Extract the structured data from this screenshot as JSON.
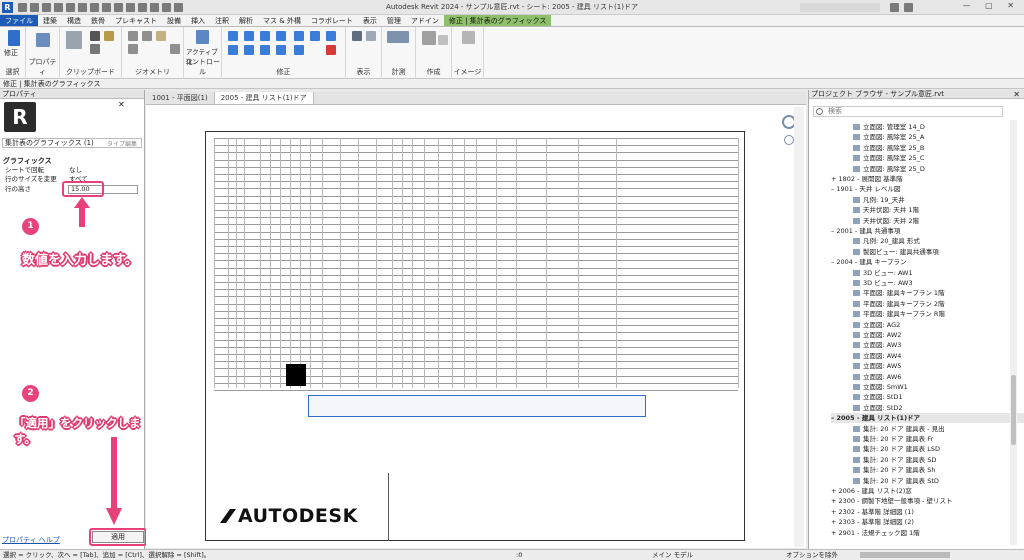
{
  "window": {
    "title": "Autodesk Revit 2024 - サンプル意匠.rvt - シート: 2005 - 建具 リスト(1)ドア",
    "controls": "— ▢ ✕"
  },
  "ribbon_tabs": [
    "ファイル",
    "建築",
    "構造",
    "鉄骨",
    "プレキャスト",
    "設備",
    "挿入",
    "注釈",
    "解析",
    "マス & 外構",
    "コラボレート",
    "表示",
    "管理",
    "アドイン",
    "修正 | 集計表のグラフィックス"
  ],
  "ribbon_groups": [
    "選択",
    "プロパティ",
    "クリップボード",
    "ジオメトリ",
    "コントロール",
    "修正",
    "表示",
    "計測",
    "作成",
    "イメージ"
  ],
  "ribbon_labels": {
    "modify": "修正",
    "select": "選択 ▾",
    "properties": "プロパティ",
    "activate": "アクティブ化"
  },
  "subbar_text": "修正 | 集計表のグラフィックス",
  "properties": {
    "header": "プロパティ",
    "thumb_letter": "R",
    "type_selector": "集計表のグラフィックス (1)",
    "edit_type": "タイプ編集",
    "category": "グラフィックス",
    "rows": [
      {
        "key": "シートで回転",
        "value": "なし"
      },
      {
        "key": "行のサイズを変更",
        "value": "すべて"
      },
      {
        "key": "行の高さ",
        "value": "15.00"
      }
    ],
    "help_link": "プロパティ ヘルプ",
    "apply_label": "適用"
  },
  "annotations": {
    "step1_badge": "1",
    "step1_text": "数値を入力します。",
    "step2_badge": "2",
    "step2_text": "「適用」をクリックします。"
  },
  "view_tabs": [
    {
      "label": "1001 - 平面図(1)",
      "active": false
    },
    {
      "label": "2005 - 建具 リスト(1)ドア",
      "active": true
    }
  ],
  "sheet": {
    "logo_text": "AUTODESK"
  },
  "browser": {
    "header": "プロジェクト ブラウザ - サンプル意匠.rvt",
    "search_placeholder": "検索",
    "items": [
      {
        "label": "立面図: 管理室 14_D",
        "indent": 2,
        "selected": false
      },
      {
        "label": "立面図: 風除室 25_A",
        "indent": 2,
        "selected": false
      },
      {
        "label": "立面図: 風除室 25_B",
        "indent": 2,
        "selected": false
      },
      {
        "label": "立面図: 風除室 25_C",
        "indent": 2,
        "selected": false
      },
      {
        "label": "立面図: 風除室 25_D",
        "indent": 2,
        "selected": false
      },
      {
        "label": "+ 1802 - 展開図 基準階",
        "indent": 0,
        "selected": false
      },
      {
        "label": "– 1901 - 天井 レベル図",
        "indent": 0,
        "selected": false
      },
      {
        "label": "凡例: 19_天井",
        "indent": 1,
        "selected": false
      },
      {
        "label": "天井伏図: 天井 1階",
        "indent": 1,
        "selected": false
      },
      {
        "label": "天井伏図: 天井 2階",
        "indent": 1,
        "selected": false
      },
      {
        "label": "– 2001 - 建具 共通事項",
        "indent": 0,
        "selected": false
      },
      {
        "label": "凡例: 20_建具 形式",
        "indent": 1,
        "selected": false
      },
      {
        "label": "製図ビュー: 建具共通事項",
        "indent": 1,
        "selected": false
      },
      {
        "label": "– 2004 - 建具 キープラン",
        "indent": 0,
        "selected": false
      },
      {
        "label": "3D ビュー: AW1",
        "indent": 1,
        "selected": false
      },
      {
        "label": "3D ビュー: AW3",
        "indent": 1,
        "selected": false
      },
      {
        "label": "平面図: 建具キープラン 1階",
        "indent": 1,
        "selected": false
      },
      {
        "label": "平面図: 建具キープラン 2階",
        "indent": 1,
        "selected": false
      },
      {
        "label": "平面図: 建具キープラン R階",
        "indent": 1,
        "selected": false
      },
      {
        "label": "立面図: AG2",
        "indent": 1,
        "selected": false
      },
      {
        "label": "立面図: AW2",
        "indent": 1,
        "selected": false
      },
      {
        "label": "立面図: AW3",
        "indent": 1,
        "selected": false
      },
      {
        "label": "立面図: AW4",
        "indent": 1,
        "selected": false
      },
      {
        "label": "立面図: AW5",
        "indent": 1,
        "selected": false
      },
      {
        "label": "立面図: AW6",
        "indent": 1,
        "selected": false
      },
      {
        "label": "立面図: SmW1",
        "indent": 1,
        "selected": false
      },
      {
        "label": "立面図: StD1",
        "indent": 1,
        "selected": false
      },
      {
        "label": "立面図: StD2",
        "indent": 1,
        "selected": false
      },
      {
        "label": "– 2005 - 建具 リスト(1)ドア",
        "indent": 0,
        "selected": true
      },
      {
        "label": "集計: 20 ドア 建具表 - 見出",
        "indent": 1,
        "selected": false
      },
      {
        "label": "集計: 20 ドア 建具表 Fr",
        "indent": 1,
        "selected": false
      },
      {
        "label": "集計: 20 ドア 建具表 LSD",
        "indent": 1,
        "selected": false
      },
      {
        "label": "集計: 20 ドア 建具表 SD",
        "indent": 1,
        "selected": false
      },
      {
        "label": "集計: 20 ドア 建具表 Sh",
        "indent": 1,
        "selected": false
      },
      {
        "label": "集計: 20 ドア 建具表 StD",
        "indent": 1,
        "selected": false
      },
      {
        "label": "+ 2006 - 建具 リスト(2)窓",
        "indent": 0,
        "selected": false
      },
      {
        "label": "+ 2300 - 鋼製下地壁一般事項 - 壁リスト",
        "indent": 0,
        "selected": false
      },
      {
        "label": "+ 2302 - 基準階 詳細図 (1)",
        "indent": 0,
        "selected": false
      },
      {
        "label": "+ 2303 - 基準階 詳細図 (2)",
        "indent": 0,
        "selected": false
      },
      {
        "label": "+ 2901 - 法規チェック図 1階",
        "indent": 0,
        "selected": false
      }
    ]
  },
  "status": {
    "hint": "選択 = クリック、次へ = [Tab]、追加 = [Ctrl]、選択解除 = [Shift]。",
    "zoom": ":0",
    "model": "メイン モデル",
    "exclude": "オプションを除外"
  },
  "colors": {
    "accent": "#1e5bb8",
    "annotation": "#e8437a",
    "context_tab": "#8ec06c"
  }
}
